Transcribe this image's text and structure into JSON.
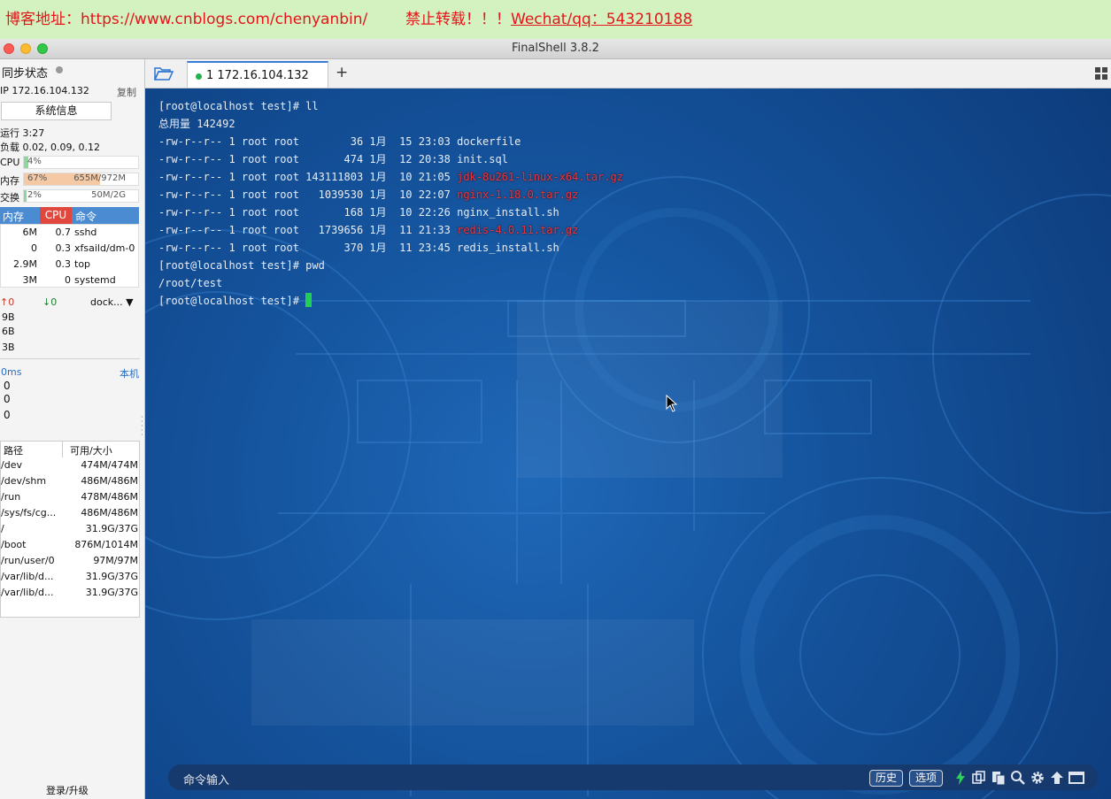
{
  "banner": {
    "blog": "博客地址：https://www.cnblogs.com/chenyanbin/",
    "notice_prefix": "禁止转载！！！",
    "notice_contact": "Wechat/qq：543210188"
  },
  "window": {
    "title": "FinalShell 3.8.2"
  },
  "sidebar": {
    "sync_label": "同步状态",
    "ip": "IP 172.16.104.132",
    "copy_label": "复制",
    "sysinfo_button": "系统信息",
    "uptime": "运行 3:27",
    "load": "负载 0.02, 0.09, 0.12",
    "cpu": {
      "label": "CPU",
      "percent_text": "4%",
      "fraction": 0.04
    },
    "mem": {
      "label": "内存",
      "percent_text": "67%",
      "detail": "655M/972M",
      "fraction": 0.67
    },
    "swap": {
      "label": "交换",
      "percent_text": "2%",
      "detail": "50M/2G",
      "fraction": 0.02
    },
    "proc_headers": {
      "mem": "内存",
      "cpu": "CPU",
      "cmd": "命令"
    },
    "processes": [
      {
        "mem": "6M",
        "cpu": "0.7",
        "cmd": "sshd"
      },
      {
        "mem": "0",
        "cpu": "0.3",
        "cmd": "xfsaild/dm-0"
      },
      {
        "mem": "2.9M",
        "cpu": "0.3",
        "cmd": "top"
      },
      {
        "mem": "3M",
        "cpu": "0",
        "cmd": "systemd"
      }
    ],
    "net": {
      "up": "0",
      "down": "0",
      "iface": "dock...",
      "rows": [
        "9B",
        "6B",
        "3B"
      ]
    },
    "ping": {
      "latency": "0ms",
      "host": "本机",
      "rows": [
        "0",
        "0",
        "0"
      ]
    },
    "disk_headers": {
      "path": "路径",
      "size": "可用/大小"
    },
    "disks": [
      {
        "path": "/dev",
        "size": "474M/474M"
      },
      {
        "path": "/dev/shm",
        "size": "486M/486M"
      },
      {
        "path": "/run",
        "size": "478M/486M"
      },
      {
        "path": "/sys/fs/cg...",
        "size": "486M/486M"
      },
      {
        "path": "/",
        "size": "31.9G/37G"
      },
      {
        "path": "/boot",
        "size": "876M/1014M"
      },
      {
        "path": "/run/user/0",
        "size": "97M/97M"
      },
      {
        "path": "/var/lib/d...",
        "size": "31.9G/37G"
      },
      {
        "path": "/var/lib/d...",
        "size": "31.9G/37G"
      }
    ],
    "login": "登录/升级"
  },
  "tabs": [
    {
      "index": "1",
      "label": "1  172.16.104.132"
    }
  ],
  "terminal": {
    "lines": [
      {
        "text": "[root@localhost test]# ll"
      },
      {
        "text": "总用量 142492"
      },
      {
        "text": "-rw-r--r-- 1 root root        36 1月  15 23:03 ",
        "file": "dockerfile",
        "red": false
      },
      {
        "text": "-rw-r--r-- 1 root root       474 1月  12 20:38 ",
        "file": "init.sql",
        "red": false
      },
      {
        "text": "-rw-r--r-- 1 root root 143111803 1月  10 21:05 ",
        "file": "jdk-8u261-linux-x64.tar.gz",
        "red": true
      },
      {
        "text": "-rw-r--r-- 1 root root   1039530 1月  10 22:07 ",
        "file": "nginx-1.18.0.tar.gz",
        "red": true
      },
      {
        "text": "-rw-r--r-- 1 root root       168 1月  10 22:26 ",
        "file": "nginx_install.sh",
        "red": false
      },
      {
        "text": "-rw-r--r-- 1 root root   1739656 1月  11 21:33 ",
        "file": "redis-4.0.11.tar.gz",
        "red": true
      },
      {
        "text": "-rw-r--r-- 1 root root       370 1月  11 23:45 ",
        "file": "redis_install.sh",
        "red": false
      },
      {
        "text": "[root@localhost test]# pwd"
      },
      {
        "text": "/root/test"
      },
      {
        "text": "[root@localhost test]# ",
        "cursor": true
      }
    ],
    "command_input_label": "命令输入",
    "history_button": "历史",
    "options_button": "选项"
  },
  "icons": [
    "folder-icon",
    "plus-icon",
    "layout-grid-icon",
    "bolt-icon",
    "copy-icon",
    "paste-icon",
    "search-icon",
    "gear-icon",
    "upload-icon",
    "window-icon"
  ],
  "colors": {
    "accent": "#3a7bd5",
    "terminal_bg": "#14529b",
    "cursor": "#21d052",
    "red_file": "#e8343a",
    "banner_text": "#e5141b"
  }
}
